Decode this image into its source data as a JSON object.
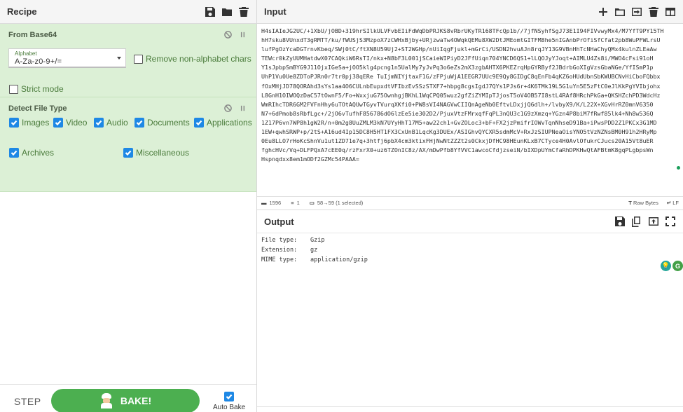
{
  "recipe": {
    "title": "Recipe",
    "operations": [
      {
        "name": "From Base64",
        "alphabet_label": "Alphabet",
        "alphabet_value": "A-Za-z0-9+/=",
        "remove_non_alpha_label": "Remove non-alphabet chars",
        "strict_mode_label": "Strict mode"
      },
      {
        "name": "Detect File Type",
        "options": [
          "Images",
          "Video",
          "Audio",
          "Documents",
          "Applications",
          "Archives",
          "Miscellaneous"
        ]
      }
    ],
    "step_label": "STEP",
    "bake_label": "BAKE!",
    "auto_bake_label": "Auto Bake"
  },
  "input": {
    "title": "Input",
    "lines": [
      "H4sIAIeJG2UC/+1XbU/jOBD+319hrSIlkULVFvbEIiFdWqDbPRJKS8vRbrUKyTR168TFcQp1b//7jfNSyhfSgJ73E1I94FIVvwyMx4/M7YfT9PY15TH",
      "hH7sku8VUnxdT3gRMTT/ku/fWUSjS3MzpoX7zCWHxBjby+URjzwaTw4OWqkQEMu8XW2DtJMEomtGITFM8he5nIGAnbPrOfiSfCfat2pb8WuPFWLrsU",
      "lufPgOzYcaDGTrnvKbeq/SWj0tC/ftXN8U59Uj2+ST2WGHp/nUiIqgFjukl+mGrCi/USDN2hvuAJn8rqJY13G9VBnHhTcNHaChyQMx4kulnZLEaAw",
      "TEWcr0kZyUUMHatdwX07CAQkiW6RsTI/nkx+N8bF3L001jSCaieWIPiyD2JFfUiqn704YNCD6QS1+lLQOJyYJoqt+AIMLU4Zs8i/MWO4cFsi91oH",
      "Y1sJpbpSmBYG9J11OjxIGeSa+jOO5klg4pcng1n5UalMy7yJvPq3o6eZs2mX3zgbAHTX6PKEZrqHpGYRByf2JBdrbGoXIgVzsGbaNGe/YfISmP1p",
      "UhP1Vu0Ue8ZDToPJRn0r7tr0pj38qERe TuIjmNIYjtaxF1G/zFPjuWjA1EEGR7UUc9E9Qy8GIDgC8qEnFb4qKZ6oHUdUbnSbKWUBCNvHiCboFQbbx",
      "fOxMHjJD78QORAhd3sYs1aa4O6CULnbEupxdtVFIbzEvSSzSTXF7+hbpg8cgsIgdJ7QYs1PJs6r+4K6TMk19L5G1uYn5E5zFtC0eJlKkPgYVIbjohx",
      "L8GnH1OIWOQzDaC57tOwnF5/Fo+WxxjuG75OwnhgjBKhL1WqCPQ05wuz2gfZiZYMIpTJjosT5oV4OB57I8stL4RAf8HRchPkGa+QKSHZchPD3WdcHz",
      "WmRIhcTDR6GM2FVFnHhy6uTOtAQUwTGyvTVurqXKfi0+PW8sVI4NAGVwCIIQnAgeNb0EftvLDxjjQ6dlh+/lvbyX9/K/L22X+XGvHrRZ0mnV6350",
      "N7+6dPmob8sRbfLgc+/2jO6vTufhF856786dO6lzEe5ie302D2/PjuxVtzFMrxqfFqPL3nQU3c1G9zXmzq+YGzn4P8biM7fRwf85lk4+Nh8w536Q",
      "1Z17P6vn7WP8h1gW2R/n+0m2g8UuZMLM3kN7UYyHhT17M5+aw22ch1+GvZOLoc3+bF+FX2jzPmifrIOWvTqnNhseD91Ba+iPwsPDD2Z1PKCx3G1MD",
      "1EW+qwhSRWP+p/2tS+A16ud4Ip15DC8H5HT1FX3CxUnB1LqcKg3DUEx/ASIGhvQYCXR5sdmMcV+RxJzSIUPNeaOisYNO5tVzNZNsBM0H91h2HRyMp",
      "0Eu8LLO7rHoKcShnVu1ut1ZD71e7q+3htfj6pbX4cm3ktixFHjNwNtZZZt2s0CkxjDfHC98HEunKLxB7CTyce4H0AvlOfukrCJucs20A15Vt8uER",
      "fghcHVc/Vq+DLFPQxA7cEE0q/rzFxrX0+uz6TZOnIC8z/AX/mDwPfb8YfVVC1awcoCfdjzseiN/bIXDpUYmCfaRhDPKHwQtAFBtmK8gqPLgbpsWn",
      "Hspnqdxx8em1mODf2GZMc54PAAA="
    ],
    "status": {
      "length": "1596",
      "lines": "1",
      "selection": "58→59 (1 selected)",
      "raw_bytes": "Raw Bytes",
      "line_ending": "LF"
    }
  },
  "output": {
    "title": "Output",
    "rows": [
      {
        "key": "File type:",
        "value": "Gzip"
      },
      {
        "key": "Extension:",
        "value": "gz"
      },
      {
        "key": "MIME type:",
        "value": "application/gzip"
      }
    ]
  },
  "colors": {
    "op_bg": "#dcf0d6",
    "bake_green": "#4caf50",
    "checkbox_blue": "#1e88e5",
    "label_green": "#4b7c3c"
  }
}
